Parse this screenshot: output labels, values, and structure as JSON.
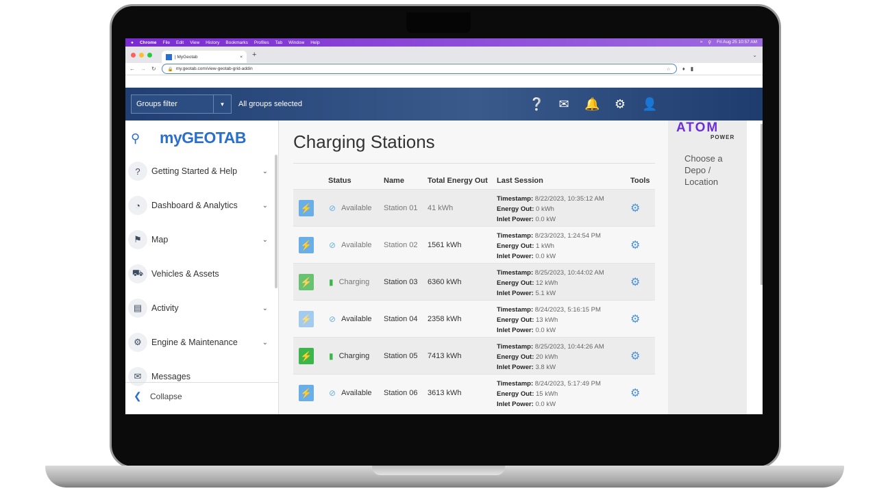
{
  "menubar": {
    "items": [
      "Chrome",
      "File",
      "Edit",
      "View",
      "History",
      "Bookmarks",
      "Profiles",
      "Tab",
      "Window",
      "Help"
    ],
    "clock": "Fri Aug 25  10:57 AM"
  },
  "browser": {
    "tab_title": "| MyGeotab",
    "url": "my.geotab.com/view-geotab-grid-addin"
  },
  "header": {
    "groups_filter": "Groups filter",
    "groups_selected": "All groups selected",
    "icons": [
      "help-icon",
      "mail-icon",
      "bell-icon",
      "gear-icon",
      "user-icon"
    ]
  },
  "sidebar": {
    "logo": "myGEOTAB",
    "items": [
      {
        "label": "Getting Started & Help",
        "icon": "help-icon",
        "chevron": true
      },
      {
        "label": "Dashboard & Analytics",
        "icon": "pie-chart-icon",
        "chevron": true
      },
      {
        "label": "Map",
        "icon": "map-icon",
        "chevron": true
      },
      {
        "label": "Vehicles & Assets",
        "icon": "truck-icon",
        "chevron": false
      },
      {
        "label": "Activity",
        "icon": "bar-chart-icon",
        "chevron": true
      },
      {
        "label": "Engine & Maintenance",
        "icon": "engine-icon",
        "chevron": true
      },
      {
        "label": "Messages",
        "icon": "envelope-icon",
        "chevron": false
      }
    ],
    "collapse": "Collapse"
  },
  "main": {
    "title": "Charging Stations",
    "columns": [
      "Status",
      "Name",
      "Total Energy Out",
      "Last Session",
      "Tools"
    ],
    "session_labels": {
      "timestamp": "Timestamp:",
      "energy": "Energy Out:",
      "inlet": "Inlet Power:"
    },
    "rows": [
      {
        "status": "Available",
        "name": "Station 01",
        "total": "41 kWh",
        "timestamp": "8/22/2023, 10:35:12 AM",
        "energy": "0 kWh",
        "inlet": "0.0 kW"
      },
      {
        "status": "Available",
        "name": "Station 02",
        "total": "1561 kWh",
        "timestamp": "8/23/2023, 1:24:54 PM",
        "energy": "1 kWh",
        "inlet": "0.0 kW"
      },
      {
        "status": "Charging",
        "name": "Station 03",
        "total": "6360 kWh",
        "timestamp": "8/25/2023, 10:44:02 AM",
        "energy": "12 kWh",
        "inlet": "5.1 kW"
      },
      {
        "status": "Available",
        "name": "Station 04",
        "total": "2358 kWh",
        "timestamp": "8/24/2023, 5:16:15 PM",
        "energy": "13 kWh",
        "inlet": "0.0 kW"
      },
      {
        "status": "Charging",
        "name": "Station 05",
        "total": "7413 kWh",
        "timestamp": "8/25/2023, 10:44:26 AM",
        "energy": "20 kWh",
        "inlet": "3.8 kW"
      },
      {
        "status": "Available",
        "name": "Station 06",
        "total": "3613 kWh",
        "timestamp": "8/24/2023, 5:17:49 PM",
        "energy": "15 kWh",
        "inlet": "0.0 kW"
      }
    ]
  },
  "right_panel": {
    "logo": "ATOM",
    "logo_sub": "POWER",
    "prompt": "Choose a Depo / Location"
  },
  "colors": {
    "available": "#6aaee8",
    "charging": "#3cb54a",
    "header": "#213f72",
    "menubar": "#7a2bd0",
    "logo": "#6b2fd6"
  }
}
